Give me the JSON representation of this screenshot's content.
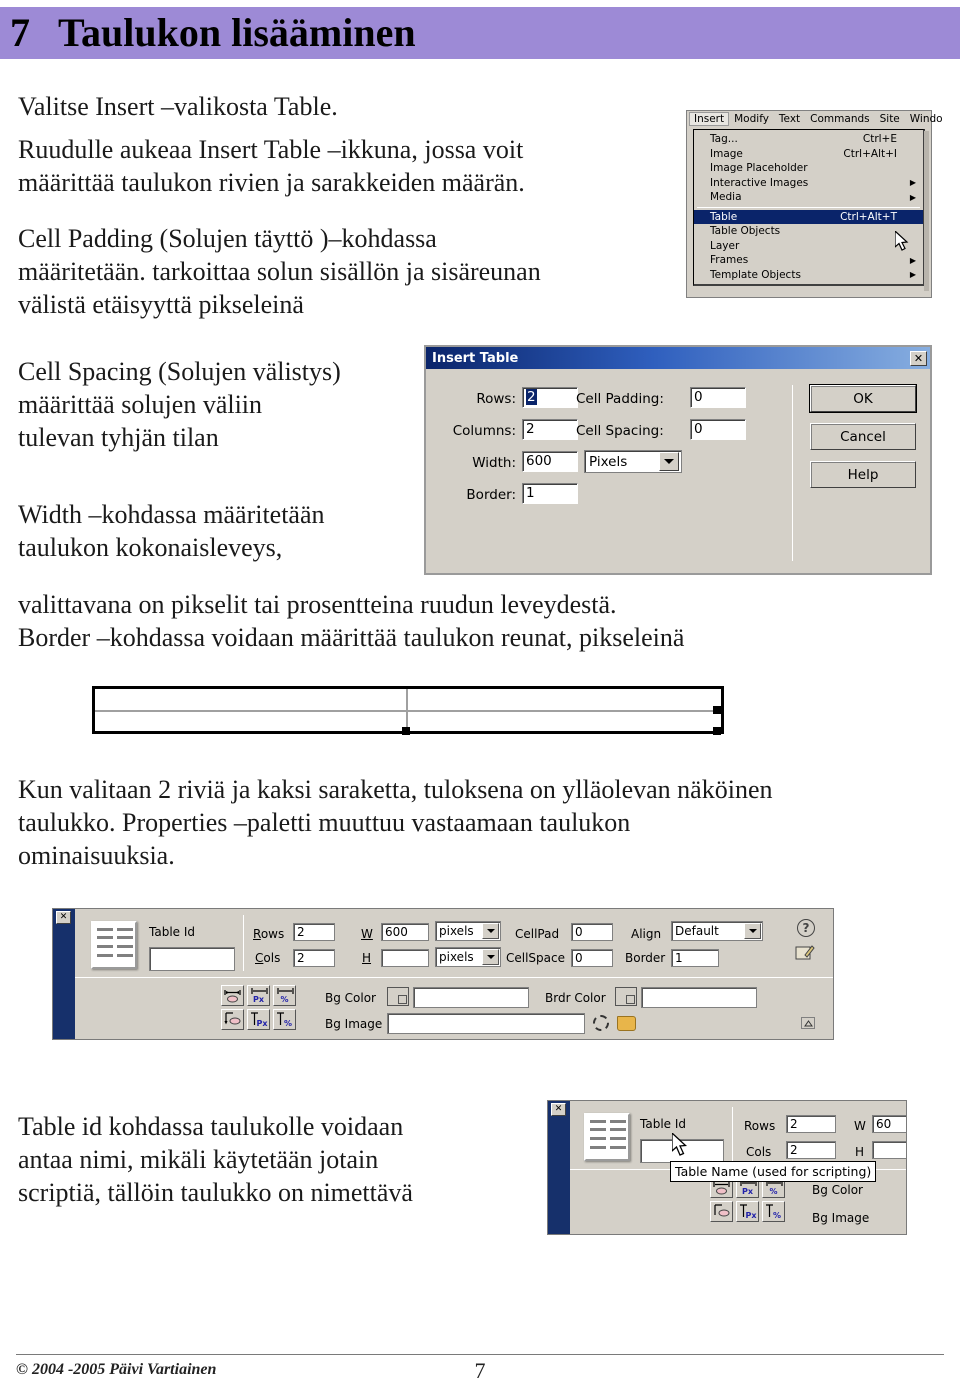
{
  "chapter": {
    "number": "7",
    "title": "Taulukon lisääminen"
  },
  "paragraphs": {
    "p1": "Valitse Insert –valikosta Table.",
    "p2": "Ruudulle aukeaa Insert Table –ikkuna, jossa voit\nmäärittää taulukon rivien ja sarakkeiden määrän.",
    "p3": "Cell Padding (Solujen täyttö )–kohdassa\nmääritetään. tarkoittaa solun sisällön ja sisäreunan\nvälistä etäisyyttä pikseleinä",
    "p4": "Cell Spacing (Solujen välistys)\nmäärittää solujen väliin\ntulevan tyhjän tilan",
    "p5": "Width –kohdassa määritetään\ntaulukon kokonaisleveys,",
    "p6": "valittavana on pikselit tai prosentteina ruudun leveydestä.\nBorder –kohdassa voidaan määrittää taulukon reunat, pikseleinä",
    "p7": "Kun valitaan 2 riviä ja kaksi saraketta, tuloksena on ylläolevan näköinen\ntaulukko. Properties –paletti muuttuu vastaamaan taulukon\nominaisuuksia.",
    "p8": "Table id kohdassa taulukolle voidaan\nantaa nimi, mikäli käytetään jotain\nscriptiä, tällöin taulukko on nimettävä"
  },
  "insert_menu": {
    "menubar": [
      {
        "label": "Insert",
        "active": true
      },
      {
        "label": "Modify",
        "active": false
      },
      {
        "label": "Text",
        "active": false
      },
      {
        "label": "Commands",
        "active": false
      },
      {
        "label": "Site",
        "active": false
      },
      {
        "label": "Windo",
        "active": false
      }
    ],
    "items": [
      {
        "label": "Tag...",
        "accel": "Ctrl+E",
        "submenu": false,
        "selected": false,
        "separator_after": false
      },
      {
        "label": "Image",
        "accel": "Ctrl+Alt+I",
        "submenu": false,
        "selected": false,
        "separator_after": false
      },
      {
        "label": "Image Placeholder",
        "accel": "",
        "submenu": false,
        "selected": false,
        "separator_after": false
      },
      {
        "label": "Interactive Images",
        "accel": "",
        "submenu": true,
        "selected": false,
        "separator_after": false
      },
      {
        "label": "Media",
        "accel": "",
        "submenu": true,
        "selected": false,
        "separator_after": true
      },
      {
        "label": "Table",
        "accel": "Ctrl+Alt+T",
        "submenu": false,
        "selected": true,
        "separator_after": false
      },
      {
        "label": "Table Objects",
        "accel": "",
        "submenu": false,
        "selected": false,
        "separator_after": false
      },
      {
        "label": "Layer",
        "accel": "",
        "submenu": false,
        "selected": false,
        "separator_after": false
      },
      {
        "label": "Frames",
        "accel": "",
        "submenu": true,
        "selected": false,
        "separator_after": false
      },
      {
        "label": "Template Objects",
        "accel": "",
        "submenu": true,
        "selected": false,
        "separator_after": false
      }
    ]
  },
  "insert_table_dialog": {
    "title": "Insert Table",
    "close_label": "✕",
    "labels": {
      "rows": "Rows:",
      "columns": "Columns:",
      "width": "Width:",
      "border": "Border:",
      "cell_padding": "Cell Padding:",
      "cell_spacing": "Cell Spacing:"
    },
    "values": {
      "rows": "2",
      "columns": "2",
      "width": "600",
      "width_unit": "Pixels",
      "border": "1",
      "cell_padding": "0",
      "cell_spacing": "0"
    },
    "buttons": {
      "ok": "OK",
      "cancel": "Cancel",
      "help": "Help"
    }
  },
  "properties_panel": {
    "close_label": "✕",
    "labels": {
      "table_id": "Table Id",
      "rows": "Rows",
      "cols": "Cols",
      "w": "W",
      "h": "H",
      "cellpad": "CellPad",
      "cellspace": "CellSpace",
      "align": "Align",
      "border": "Border",
      "bg_color": "Bg Color",
      "brdr_color": "Brdr Color",
      "bg_image": "Bg Image"
    },
    "values": {
      "table_id": "",
      "rows": "2",
      "cols": "2",
      "w": "600",
      "h": "",
      "w_unit": "pixels",
      "h_unit": "pixels",
      "cellpad": "0",
      "cellspace": "0",
      "align": "Default",
      "border": "1",
      "bg_color": "",
      "brdr_color": "",
      "bg_image": ""
    },
    "buttons": {
      "clear_w": "",
      "convert_w_px": "Px",
      "convert_w_pct": "%",
      "clear_h": "",
      "convert_h_px": "Px",
      "convert_h_pct": "%",
      "help": "?"
    }
  },
  "tooltip_screenshot": {
    "close_label": "✕",
    "labels": {
      "table_id": "Table Id",
      "rows": "Rows",
      "cols": "Cols",
      "w": "W",
      "h": "H",
      "bg_color": "Bg Color",
      "bg_image": "Bg Image"
    },
    "values": {
      "rows": "2",
      "cols": "2",
      "w": "60"
    },
    "tooltip_text": "Table Name (used for scripting)"
  },
  "footer": {
    "copyright": "© 2004 -2005 Päivi Vartiainen",
    "page_number": "7"
  },
  "colors": {
    "header_band": "#9d8ad6",
    "dialog_title": "#0a246a",
    "menu_highlight": "#0a246a",
    "panel_face": "#d4d0c8",
    "panel_gutter": "#16306b"
  }
}
